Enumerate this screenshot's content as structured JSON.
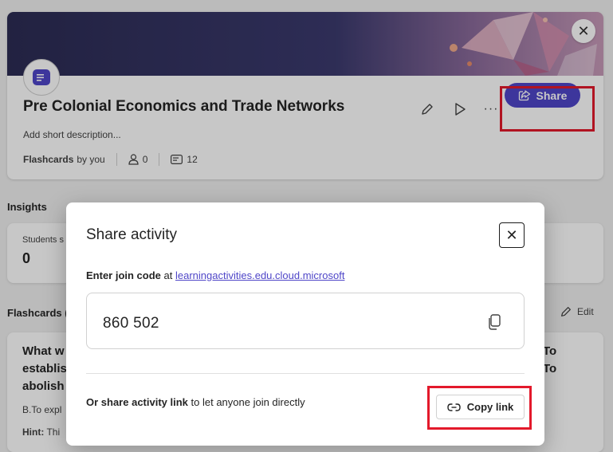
{
  "activity": {
    "title": "Pre Colonial Economics and Trade Networks",
    "description_placeholder": "Add short description...",
    "type": "Flashcards",
    "owner": "by you",
    "participants_count": "0",
    "cards_count": "12",
    "share_label": "Share"
  },
  "insights": {
    "section_label": "Insights",
    "stat_label": "Students s",
    "stat_value": "0"
  },
  "flashcards": {
    "section_label": "Flashcards (",
    "edit_label": "Edit",
    "card_question_lines": [
      "What w",
      "establis",
      "abolish"
    ],
    "card_question_right_lines": [
      "To",
      "To"
    ],
    "card_answer": "B.To expl",
    "card_hint_label": "Hint:",
    "card_hint_text": "Thi"
  },
  "dialog": {
    "title": "Share activity",
    "join_prefix": "Enter join code",
    "join_at": "at",
    "join_url": "learningactivities.edu.cloud.microsoft",
    "join_code": "860 502",
    "share_link_bold": "Or share activity link",
    "share_link_rest": "to let anyone join directly",
    "copy_link_label": "Copy link"
  },
  "colors": {
    "accent": "#4f46c8",
    "highlight": "#e3192b"
  }
}
